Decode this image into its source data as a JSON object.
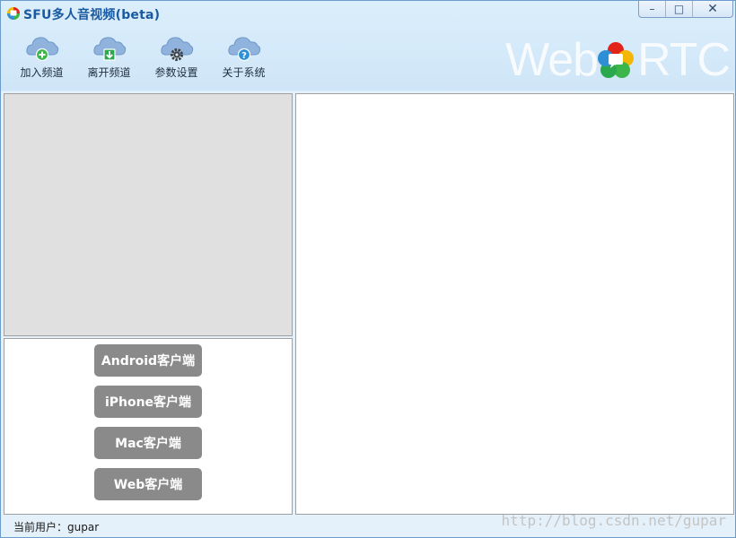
{
  "window": {
    "title": "SFU多人音视频(beta)",
    "controls": {
      "minimize": "–",
      "maximize": "□",
      "close": "✕"
    }
  },
  "toolbar": {
    "items": [
      {
        "label": "加入频道",
        "icon": "cloud-add-icon",
        "badge_color": "#3cb54a"
      },
      {
        "label": "离开频道",
        "icon": "cloud-download-icon",
        "badge_color": "#2aa84e"
      },
      {
        "label": "参数设置",
        "icon": "cloud-gear-icon",
        "badge_color": "#3d3d3d"
      },
      {
        "label": "关于系统",
        "icon": "cloud-help-icon",
        "badge_color": "#2e8fd6"
      }
    ]
  },
  "logo": {
    "left_word": "Web",
    "right_word": "RTC"
  },
  "clients": {
    "buttons": [
      {
        "label": "Android客户端"
      },
      {
        "label": "iPhone客户端"
      },
      {
        "label": "Mac客户端"
      },
      {
        "label": "Web客户端"
      }
    ]
  },
  "status": {
    "current_user": "当前用户：gupar"
  },
  "watermark": "http://blog.csdn.net/gupar",
  "colors": {
    "accent": "#1a5aa0",
    "button_gray": "#8a8a8a",
    "video_bg": "#e0e0e0"
  }
}
